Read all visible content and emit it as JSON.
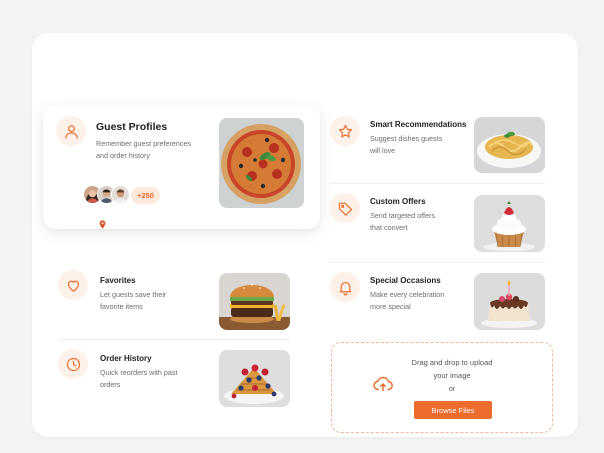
{
  "accent_color": "#ec6d2e",
  "featured": {
    "title": "Guest Profiles",
    "description": "Remember guest preferences\nand order history",
    "icon": "user-icon",
    "extra_count": "+250"
  },
  "left_features": [
    {
      "title": "Favorites",
      "description": "Let guests save their\nfavorite items",
      "icon": "heart-icon"
    },
    {
      "title": "Order History",
      "description": "Quick reorders with past\norders",
      "icon": "clock-icon"
    }
  ],
  "right_features": [
    {
      "title": "Smart Recommendations",
      "description": "Suggest dishes guests\nwill love",
      "icon": "star-icon"
    },
    {
      "title": "Custom Offers",
      "description": "Send targeted offers\nthat convert",
      "icon": "tag-icon"
    },
    {
      "title": "Special Occasions",
      "description": "Make every celebration\nmore special",
      "icon": "bell-icon"
    }
  ],
  "upload": {
    "line1": "Drag and drop to upload",
    "line2": "your image",
    "or": "or",
    "button": "Browse Files",
    "icon": "cloud-upload-icon"
  }
}
